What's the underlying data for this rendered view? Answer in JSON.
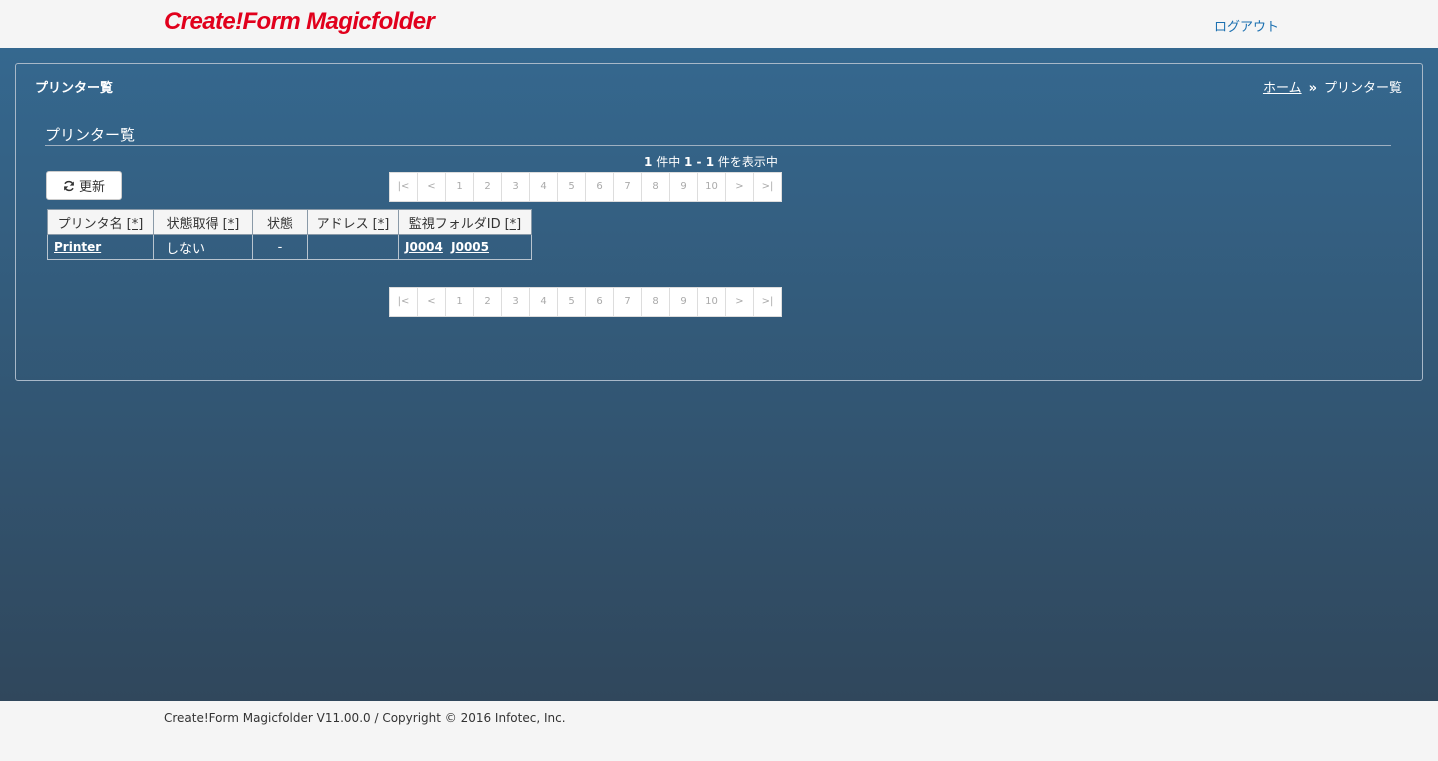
{
  "header": {
    "logo": "Create!Form Magicfolder",
    "logout": "ログアウト"
  },
  "panel": {
    "title": "プリンター覧",
    "breadcrumb": {
      "home": "ホーム",
      "separator": "»",
      "current": "プリンター覧"
    }
  },
  "section": {
    "title": "プリンター覧",
    "count": {
      "total": "1",
      "unit1": "件中",
      "range": "1 - 1",
      "unit2": "件を表示中"
    },
    "refresh_label": "更新"
  },
  "pager": [
    "|<",
    "<",
    "1",
    "2",
    "3",
    "4",
    "5",
    "6",
    "7",
    "8",
    "9",
    "10",
    ">",
    ">|"
  ],
  "table": {
    "columns": [
      {
        "label": "プリンタ名",
        "sort": "[*]"
      },
      {
        "label": "状態取得",
        "sort": "[*]"
      },
      {
        "label": "状態",
        "sort": ""
      },
      {
        "label": "アドレス",
        "sort": "[*]"
      },
      {
        "label": "監視フォルダID",
        "sort": "[*]"
      }
    ],
    "rows": [
      {
        "name": "Printer",
        "status_fetch": "しない",
        "status": "-",
        "address": "",
        "folders": [
          "J0004",
          "J0005"
        ]
      }
    ]
  },
  "footer": {
    "text": "Create!Form Magicfolder V11.00.0 / Copyright © 2016 Infotec, Inc."
  }
}
